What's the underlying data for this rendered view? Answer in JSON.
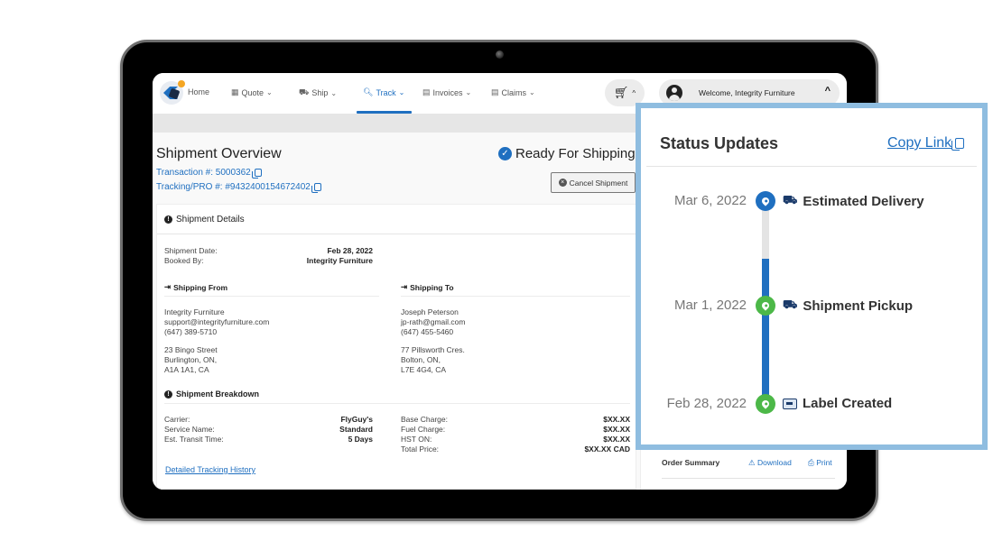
{
  "nav": {
    "items": [
      {
        "label": "Home",
        "icon": "logo-icon"
      },
      {
        "label": "Quote",
        "icon": "calculator-icon"
      },
      {
        "label": "Ship",
        "icon": "truck-icon"
      },
      {
        "label": "Track",
        "icon": "search-icon",
        "active": true
      },
      {
        "label": "Invoices",
        "icon": "file-icon"
      },
      {
        "label": "Claims",
        "icon": "file-icon"
      }
    ],
    "cart_icon": "cart-icon",
    "welcome": "Welcome, Integrity Furniture"
  },
  "overview": {
    "title": "Shipment Overview",
    "transaction": "Transaction #: 5000362",
    "tracking": "Tracking/PRO #: #9432400154672402",
    "status": "Ready For Shipping",
    "cancel_label": "Cancel Shipment"
  },
  "details": {
    "title": "Shipment Details",
    "rows": [
      {
        "k": "Shipment Date:",
        "v": "Feb 28, 2022"
      },
      {
        "k": "Booked By:",
        "v": "Integrity Furniture"
      }
    ],
    "from": {
      "title": "Shipping From",
      "contact": [
        "Integrity Furniture",
        "support@integrityfurniture.com",
        "(647) 389-5710"
      ],
      "address": [
        "23 Bingo Street",
        "Burlington, ON,",
        "A1A 1A1, CA"
      ]
    },
    "to": {
      "title": "Shipping To",
      "contact": [
        "Joseph Peterson",
        "jp-rath@gmail.com",
        "(647) 455-5460"
      ],
      "address": [
        "77 Pillsworth Cres.",
        "Bolton, ON,",
        "L7E 4G4, CA"
      ]
    },
    "breakdown": {
      "title": "Shipment Breakdown",
      "left": [
        {
          "k": "Carrier:",
          "v": "FlyGuy's"
        },
        {
          "k": "Service Name:",
          "v": "Standard"
        },
        {
          "k": "Est. Transit Time:",
          "v": "5 Days"
        }
      ],
      "right": [
        {
          "k": "Base Charge:",
          "v": "$XX.XX"
        },
        {
          "k": "Fuel Charge:",
          "v": "$XX.XX"
        },
        {
          "k": "HST ON:",
          "v": "$XX.XX"
        },
        {
          "k": "Total Price:",
          "v": "$XX.XX CAD"
        }
      ]
    },
    "history_link": "Detailed Tracking History"
  },
  "order_summary": {
    "title": "Order Summary",
    "download": "Download",
    "print": "Print"
  },
  "status_updates": {
    "title": "Status Updates",
    "copy_link": "Copy Link",
    "events": [
      {
        "date": "Mar 6, 2022",
        "label": "Estimated Delivery",
        "state": "upcoming",
        "icon": "truck-icon"
      },
      {
        "date": "Mar 1, 2022",
        "label": "Shipment Pickup",
        "state": "done",
        "icon": "truck-icon"
      },
      {
        "date": "Feb 28, 2022",
        "label": "Label Created",
        "state": "done",
        "icon": "label-icon"
      }
    ]
  }
}
